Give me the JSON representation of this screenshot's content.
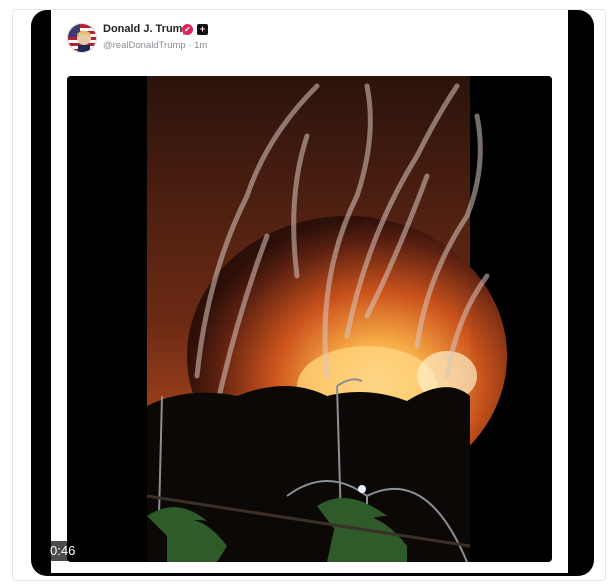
{
  "post": {
    "author_name": "Donald J. Trump",
    "handle": "@realDonaldTrump",
    "time": "1m",
    "handle_line": "@realDonaldTrump · 1m",
    "verified_icon": "verified-badge-icon",
    "plus_icon": "plus-square-icon"
  },
  "video": {
    "duration": "0:46"
  },
  "colors": {
    "verified": "#e0245e",
    "name_text": "#222222",
    "handle_text": "#8a8f96",
    "player_bg": "#000000"
  }
}
